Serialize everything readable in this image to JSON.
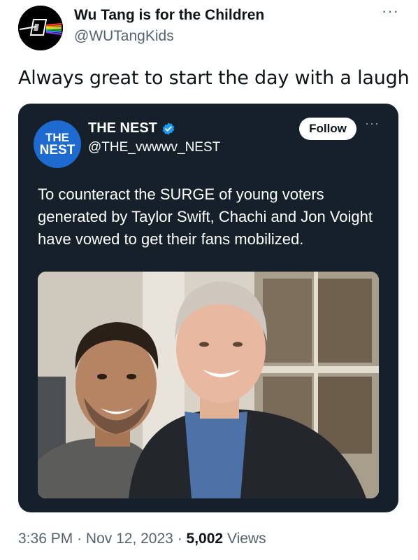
{
  "tweet": {
    "author_name": "Wu Tang is for the Children",
    "author_handle": "@WUTangKids",
    "more_label": "···",
    "text": "Always great to start the day with a laugh",
    "time": "3:36 PM",
    "separator": "·",
    "date": "Nov 12, 2023",
    "views_count": "5,002",
    "views_label": "Views"
  },
  "quoted": {
    "logo_line1": "THE",
    "logo_line2": "NEST",
    "name": "THE NEST",
    "handle": "@THE_vwwwv_NEST",
    "follow_label": "Follow",
    "more_label": "···",
    "text": "To counteract the SURGE of young voters generated by Taylor Swift, Chachi and Jon Voight have vowed to get their fans mobilized.",
    "verified_color": "#1d9bf0"
  },
  "icons": {
    "avatar": "wu-tang-prism-icon",
    "verified": "verified-badge-icon",
    "more": "more-options-icon"
  }
}
